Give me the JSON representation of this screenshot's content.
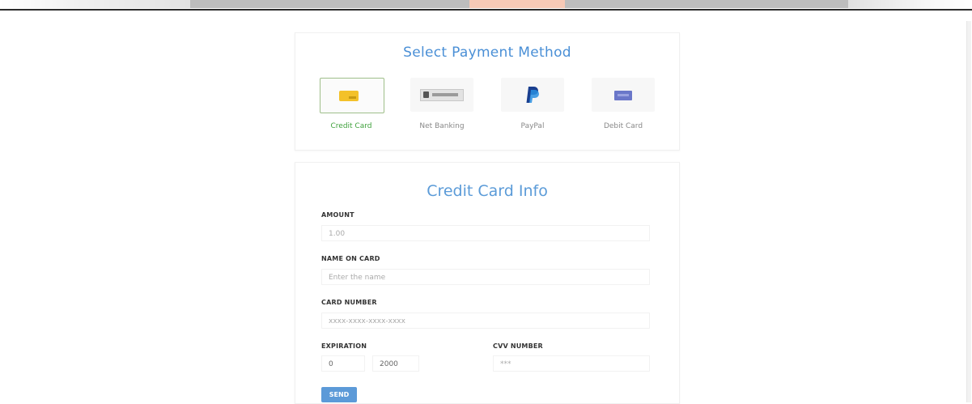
{
  "payment_methods": {
    "title": "Select Payment Method",
    "selected": "Credit Card",
    "items": [
      {
        "label": "Credit Card",
        "icon": "credit-card-icon"
      },
      {
        "label": "Net Banking",
        "icon": "net-banking-icon"
      },
      {
        "label": "PayPal",
        "icon": "paypal-icon"
      },
      {
        "label": "Debit Card",
        "icon": "debit-card-icon"
      }
    ]
  },
  "card_info": {
    "title": "Credit Card Info",
    "amount": {
      "label": "AMOUNT",
      "placeholder": "1.00"
    },
    "name_on_card": {
      "label": "NAME ON CARD",
      "placeholder": "Enter the name"
    },
    "card_number": {
      "label": "CARD NUMBER",
      "placeholder": "xxxx-xxxx-xxxx-xxxx"
    },
    "expiration": {
      "label": "EXPIRATION",
      "month": "0",
      "year": "2000"
    },
    "cvv": {
      "label": "CVV NUMBER",
      "placeholder": "***"
    },
    "send_label": "SEND"
  },
  "colors": {
    "accent": "#5b9bd8",
    "active_green": "#3fa13c",
    "send_button": "#5c9ad8"
  }
}
